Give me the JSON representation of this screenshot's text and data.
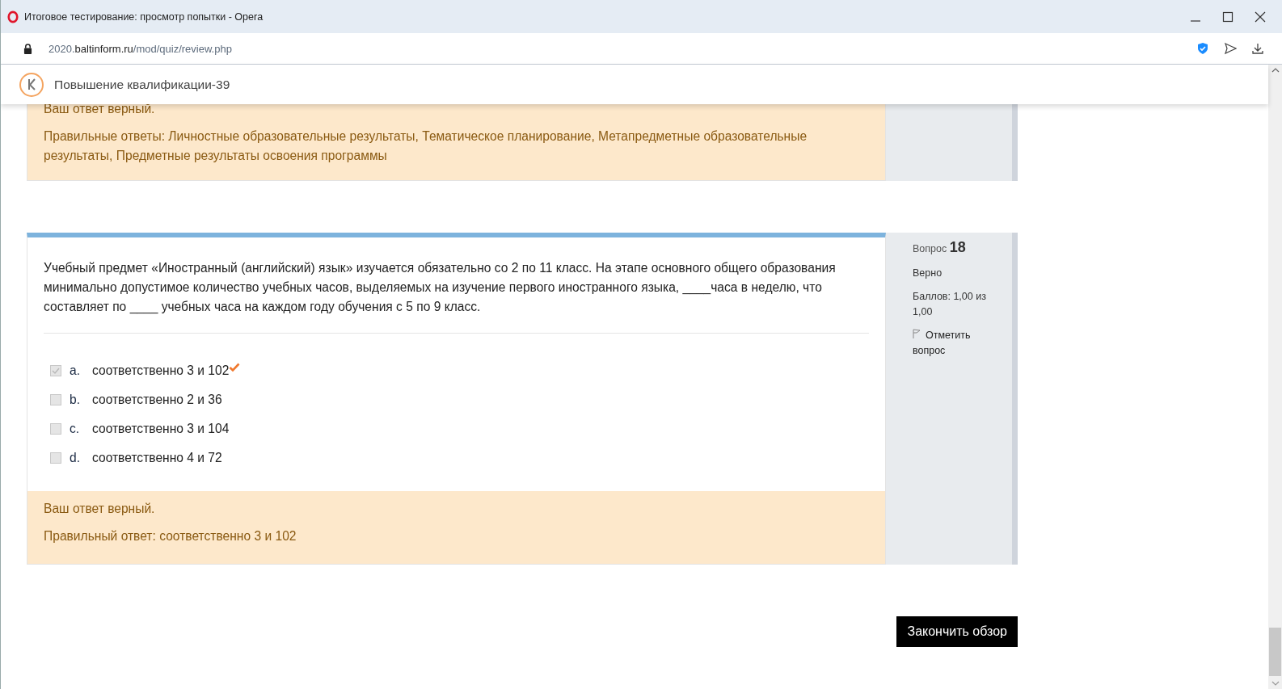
{
  "window": {
    "title": "Итоговое тестирование: просмотр попытки - Opera"
  },
  "address_bar": {
    "url_prefix": "2020.",
    "url_domain": "baltinform.ru",
    "url_path": "/mod/quiz/review.php"
  },
  "site_header": {
    "title": "Повышение квалификации-39"
  },
  "previous_feedback": {
    "status": "Ваш ответ верный.",
    "right_answer": "Правильные ответы: Личностные образовательные результаты, Тематическое планирование, Метапредметные образовательные результаты, Предметные результаты освоения программы"
  },
  "question": {
    "label": "Вопрос",
    "number": "18",
    "state": "Верно",
    "grade": "Баллов: 1,00 из 1,00",
    "flag": "Отметить вопрос",
    "text": "Учебный предмет «Иностранный (английский) язык» изучается обязательно со 2 по 11 класс. На этапе основного общего образования минимально допустимое количество учебных часов, выделяемых на изучение первого иностранного языка, ____часа в неделю, что составляет по ____ учебных часа на каждом году обучения с 5 по 9 класс.",
    "options": [
      {
        "letter": "a.",
        "text": "соответственно 3 и 102",
        "checked": true,
        "correct": true
      },
      {
        "letter": "b.",
        "text": "соответственно 2 и 36",
        "checked": false,
        "correct": false
      },
      {
        "letter": "c.",
        "text": "соответственно 3 и 104",
        "checked": false,
        "correct": false
      },
      {
        "letter": "d.",
        "text": "соответственно 4 и 72",
        "checked": false,
        "correct": false
      }
    ],
    "feedback": {
      "status": "Ваш ответ верный.",
      "right_answer": "Правильный ответ: соответственно 3 и 102"
    }
  },
  "finish_button": "Закончить обзор"
}
